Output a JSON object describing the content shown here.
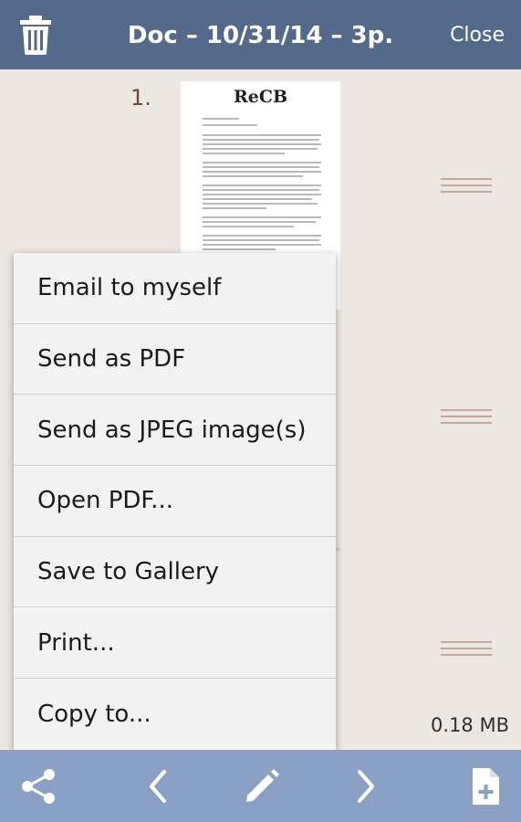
{
  "header": {
    "title": "Doc – 10/31/14 – 3p.",
    "close_label": "Close",
    "delete_icon": "trash-icon"
  },
  "pages": [
    {
      "number": "1.",
      "thumbnail_logo": "ReCB"
    }
  ],
  "file_size": "0.18 MB",
  "menu": {
    "items": [
      {
        "label": "Email to myself"
      },
      {
        "label": "Send as PDF"
      },
      {
        "label": "Send as JPEG image(s)"
      },
      {
        "label": "Open PDF..."
      },
      {
        "label": "Save to Gallery"
      },
      {
        "label": "Print..."
      },
      {
        "label": "Copy to..."
      }
    ]
  },
  "bottom_bar": {
    "icons": [
      "share-icon",
      "chevron-left-icon",
      "pencil-icon",
      "chevron-right-icon",
      "add-page-icon"
    ]
  },
  "colors": {
    "header_bg": "#556a8b",
    "bottom_bar_bg": "#8aa0c4",
    "background": "#ece7e3",
    "menu_bg": "#f2f2f2"
  }
}
